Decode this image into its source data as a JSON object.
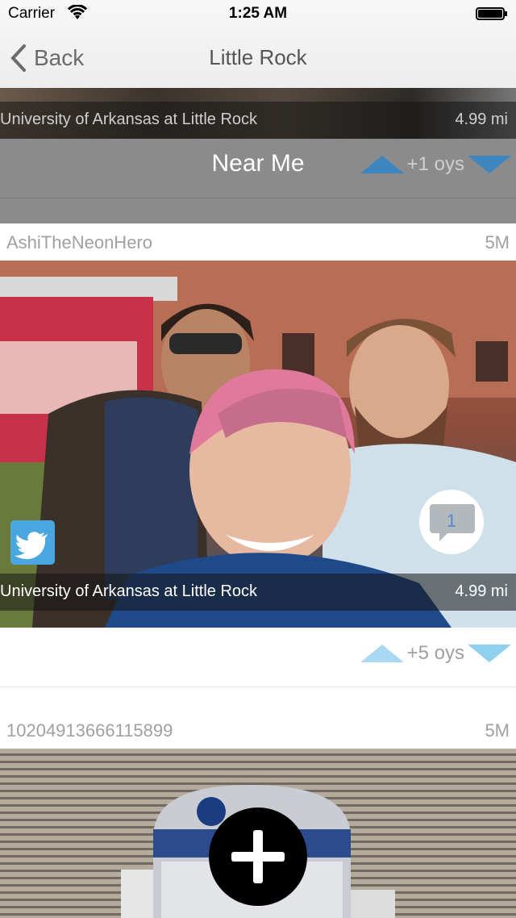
{
  "status": {
    "carrier": "Carrier",
    "time": "1:25 AM"
  },
  "nav": {
    "back_label": "Back",
    "title": "Little Rock"
  },
  "partial_card": {
    "location": "University of Arkansas at Little Rock",
    "distance": "4.99 mi"
  },
  "near_me": {
    "heading": "Near Me",
    "votes": "+1 oys"
  },
  "posts": [
    {
      "user": "AshiTheNeonHero",
      "age": "5M",
      "location": "University of Arkansas at Little Rock",
      "distance": "4.99 mi",
      "comment_count": "1",
      "votes": "+5 oys"
    },
    {
      "user": "10204913666115899",
      "age": "5M"
    }
  ],
  "colors": {
    "vote_up_active": "#3d86c0",
    "vote_up_light": "#a9d9f2",
    "vote_down": "#47b4e6",
    "twitter": "#4aa6e0",
    "near_me_bg": "#8b8b8b"
  }
}
